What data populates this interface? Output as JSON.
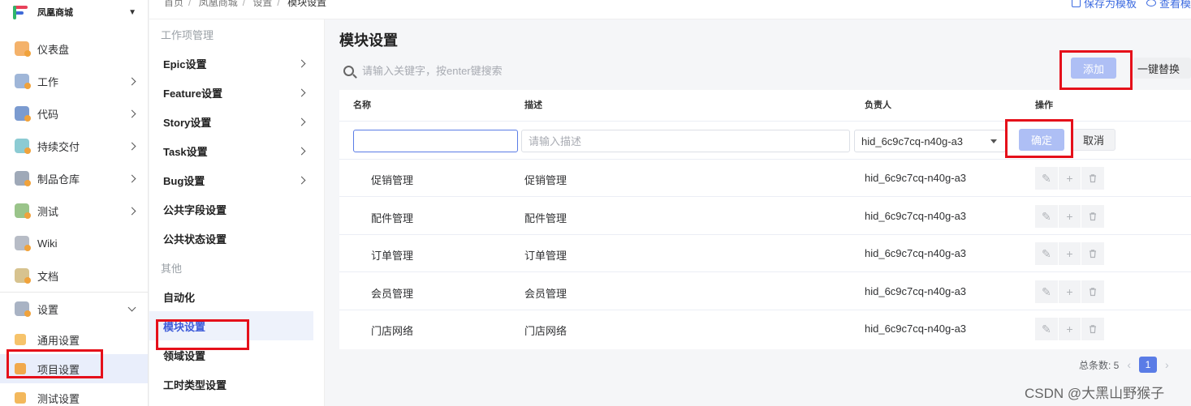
{
  "brand": {
    "name": "凤凰商城"
  },
  "sidebar": {
    "items": [
      {
        "label": "仪表盘",
        "icon": "dashboard-icon",
        "color": "#f4b26b",
        "chevron": false
      },
      {
        "label": "工作",
        "icon": "work-icon",
        "color": "#9fb6d8",
        "chevron": true
      },
      {
        "label": "代码",
        "icon": "code-icon",
        "color": "#7b9bd0",
        "chevron": true
      },
      {
        "label": "持续交付",
        "icon": "delivery-icon",
        "color": "#8ccbd3",
        "chevron": true
      },
      {
        "label": "制品仓库",
        "icon": "artifact-icon",
        "color": "#9fa9b8",
        "chevron": true
      },
      {
        "label": "测试",
        "icon": "test-icon",
        "color": "#9ac48a",
        "chevron": true
      },
      {
        "label": "Wiki",
        "icon": "wiki-icon",
        "color": "#b7bcc6",
        "chevron": false
      },
      {
        "label": "文档",
        "icon": "document-icon",
        "color": "#d7c38f",
        "chevron": false
      }
    ],
    "settings": {
      "label": "设置",
      "icon": "settings-icon"
    },
    "sub_items": [
      {
        "label": "通用设置",
        "icon": "general-settings-icon",
        "active": false
      },
      {
        "label": "项目设置",
        "icon": "project-settings-icon",
        "active": true
      },
      {
        "label": "测试设置",
        "icon": "test-settings-icon",
        "active": false
      }
    ]
  },
  "breadcrumb": [
    "首页",
    "凤凰商城",
    "设置",
    "模块设置"
  ],
  "top_actions": {
    "save_template": "保存为模板",
    "view_template": "查看模"
  },
  "settings_menu": {
    "group1": "工作项管理",
    "items1": [
      {
        "label": "Epic设置",
        "chevron": true
      },
      {
        "label": "Feature设置",
        "chevron": true
      },
      {
        "label": "Story设置",
        "chevron": true
      },
      {
        "label": "Task设置",
        "chevron": true
      },
      {
        "label": "Bug设置",
        "chevron": true
      },
      {
        "label": "公共字段设置",
        "chevron": false
      },
      {
        "label": "公共状态设置",
        "chevron": false
      }
    ],
    "group2": "其他",
    "items2": [
      {
        "label": "自动化",
        "active": false
      },
      {
        "label": "模块设置",
        "active": true
      },
      {
        "label": "领域设置",
        "active": false
      },
      {
        "label": "工时类型设置",
        "active": false
      }
    ]
  },
  "main": {
    "title": "模块设置",
    "search_placeholder": "请输入关键字，按enter键搜索",
    "add_label": "添加",
    "replace_label": "一键替换",
    "columns": {
      "name": "名称",
      "desc": "描述",
      "owner": "负责人",
      "ops": "操作"
    },
    "edit_row": {
      "name_value": "",
      "desc_placeholder": "请输入描述",
      "owner_value": "hid_6c9c7cq-n40g-a3",
      "ok_label": "确定",
      "cancel_label": "取消"
    },
    "rows": [
      {
        "name": "促销管理",
        "desc": "促销管理",
        "owner": "hid_6c9c7cq-n40g-a3"
      },
      {
        "name": "配件管理",
        "desc": "配件管理",
        "owner": "hid_6c9c7cq-n40g-a3"
      },
      {
        "name": "订单管理",
        "desc": "订单管理",
        "owner": "hid_6c9c7cq-n40g-a3"
      },
      {
        "name": "会员管理",
        "desc": "会员管理",
        "owner": "hid_6c9c7cq-n40g-a3"
      },
      {
        "name": "门店网络",
        "desc": "门店网络",
        "owner": "hid_6c9c7cq-n40g-a3"
      }
    ],
    "pagination": {
      "total_label": "总条数: 5",
      "current": "1"
    }
  },
  "watermark": "CSDN @大黑山野猴子",
  "colors": {
    "accent": "#5a7ce6",
    "highlight": "#e5101a",
    "disabled_primary": "#aebff5"
  }
}
